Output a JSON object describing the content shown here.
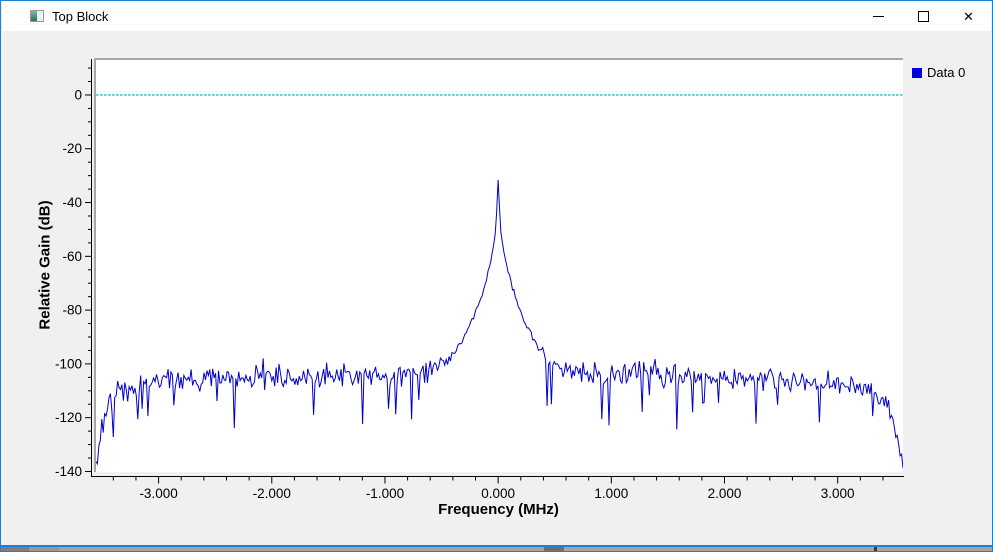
{
  "window": {
    "title": "Top Block",
    "controls": {
      "minimize": "minimize",
      "maximize": "maximize",
      "close": "close"
    }
  },
  "legend": {
    "position": "top-right",
    "items": [
      {
        "label": "Data 0",
        "color": "#0000e0"
      }
    ]
  },
  "chart_data": {
    "type": "line",
    "title": "",
    "xlabel": "Frequency (MHz)",
    "ylabel": "Relative Gain (dB)",
    "xlim": [
      -3.553,
      3.577
    ],
    "ylim": [
      -140.2,
      13.0
    ],
    "grid": "off",
    "legend_position": "top-right",
    "x_ticks": {
      "major_values": [
        -3,
        -2,
        -1,
        0,
        1,
        2,
        3
      ],
      "major_labels": [
        "-3.000",
        "-2.000",
        "-1.000",
        "0.000",
        "1.000",
        "2.000",
        "3.000"
      ],
      "minor_step": 0.2
    },
    "y_ticks": {
      "major_values": [
        0,
        -20,
        -40,
        -60,
        -80,
        -100,
        -120,
        -140
      ],
      "major_labels": [
        "0",
        "-20",
        "-40",
        "-60",
        "-80",
        "-100",
        "-120",
        "-140"
      ],
      "minor_step": 5,
      "minor_max": 10
    },
    "zero_line": {
      "value": 0,
      "style": "dotted",
      "color": "#00cccc",
      "color2": "#006a6a"
    },
    "series": [
      {
        "name": "Data 0",
        "color": "#0000cc",
        "peak": {
          "freq_mhz": 0.0,
          "level_db": -31.5
        },
        "noise_floor_db": -105,
        "samples": 560,
        "noise": {
          "floor_sigma": 5.0,
          "skirt_sigma": 1.6,
          "dip_prob": 0.055,
          "dip_depth_max": 18,
          "spike_prob": 0.02,
          "seed": 20
        },
        "envelope_db": [
          [
            -3.553,
            -137
          ],
          [
            -3.545,
            -122
          ],
          [
            -3.54,
            -136
          ],
          [
            -3.52,
            -130
          ],
          [
            -3.5,
            -121
          ],
          [
            -3.48,
            -124
          ],
          [
            -3.46,
            -116
          ],
          [
            -3.43,
            -113
          ],
          [
            -3.4,
            -114
          ],
          [
            -3.36,
            -111
          ],
          [
            -3.3,
            -111
          ],
          [
            -3.22,
            -109
          ],
          [
            -3.1,
            -107.5
          ],
          [
            -2.95,
            -106.5
          ],
          [
            -2.8,
            -106
          ],
          [
            -2.6,
            -105.5
          ],
          [
            -2.4,
            -105.5
          ],
          [
            -2.2,
            -105
          ],
          [
            -2.0,
            -105
          ],
          [
            -1.8,
            -104.5
          ],
          [
            -1.6,
            -104.5
          ],
          [
            -1.4,
            -104
          ],
          [
            -1.2,
            -104
          ],
          [
            -1.0,
            -104
          ],
          [
            -0.85,
            -104
          ],
          [
            -0.72,
            -103.5
          ],
          [
            -0.62,
            -103
          ],
          [
            -0.55,
            -102
          ],
          [
            -0.5,
            -100.5
          ],
          [
            -0.45,
            -98.5
          ],
          [
            -0.4,
            -96
          ],
          [
            -0.35,
            -93
          ],
          [
            -0.3,
            -89.5
          ],
          [
            -0.26,
            -86
          ],
          [
            -0.22,
            -82.5
          ],
          [
            -0.18,
            -78.5
          ],
          [
            -0.15,
            -75
          ],
          [
            -0.12,
            -71
          ],
          [
            -0.1,
            -68
          ],
          [
            -0.08,
            -64.5
          ],
          [
            -0.065,
            -61.5
          ],
          [
            -0.05,
            -58
          ],
          [
            -0.04,
            -55.5
          ],
          [
            -0.03,
            -53
          ],
          [
            -0.022,
            -50
          ],
          [
            -0.016,
            -47
          ],
          [
            -0.012,
            -42
          ],
          [
            -0.008,
            -35
          ],
          [
            -0.004,
            -32
          ],
          [
            0,
            -31.5
          ],
          [
            0.004,
            -32
          ],
          [
            0.008,
            -35
          ],
          [
            0.012,
            -42
          ],
          [
            0.016,
            -47
          ],
          [
            0.022,
            -50
          ],
          [
            0.03,
            -53
          ],
          [
            0.04,
            -55.5
          ],
          [
            0.05,
            -58
          ],
          [
            0.065,
            -61.5
          ],
          [
            0.08,
            -64.5
          ],
          [
            0.1,
            -68
          ],
          [
            0.12,
            -71
          ],
          [
            0.15,
            -75
          ],
          [
            0.18,
            -78.5
          ],
          [
            0.22,
            -82.5
          ],
          [
            0.26,
            -86
          ],
          [
            0.3,
            -89.5
          ],
          [
            0.35,
            -93
          ],
          [
            0.4,
            -96
          ],
          [
            0.45,
            -98.5
          ],
          [
            0.5,
            -100.5
          ],
          [
            0.55,
            -102
          ],
          [
            0.62,
            -103
          ],
          [
            0.72,
            -103.5
          ],
          [
            0.85,
            -104
          ],
          [
            1.0,
            -104
          ],
          [
            1.2,
            -104
          ],
          [
            1.4,
            -104.5
          ],
          [
            1.6,
            -104.5
          ],
          [
            1.8,
            -105
          ],
          [
            2.0,
            -105
          ],
          [
            2.2,
            -105.5
          ],
          [
            2.4,
            -105.5
          ],
          [
            2.6,
            -106
          ],
          [
            2.8,
            -106
          ],
          [
            2.95,
            -106.5
          ],
          [
            3.1,
            -107
          ],
          [
            3.22,
            -108.5
          ],
          [
            3.3,
            -110
          ],
          [
            3.36,
            -111.5
          ],
          [
            3.4,
            -113
          ],
          [
            3.44,
            -115
          ],
          [
            3.47,
            -118
          ],
          [
            3.5,
            -122
          ],
          [
            3.53,
            -128
          ],
          [
            3.55,
            -134
          ],
          [
            3.57,
            -139
          ]
        ]
      }
    ]
  },
  "colors": {
    "window_border": "#1683d8",
    "titlebar_bg": "#ffffff",
    "content_bg": "#f0f0f0",
    "canvas_bg": "#ffffff",
    "canvas_frame": "#a6a6a6",
    "axis": "#000000",
    "tick_label": "#000000"
  }
}
